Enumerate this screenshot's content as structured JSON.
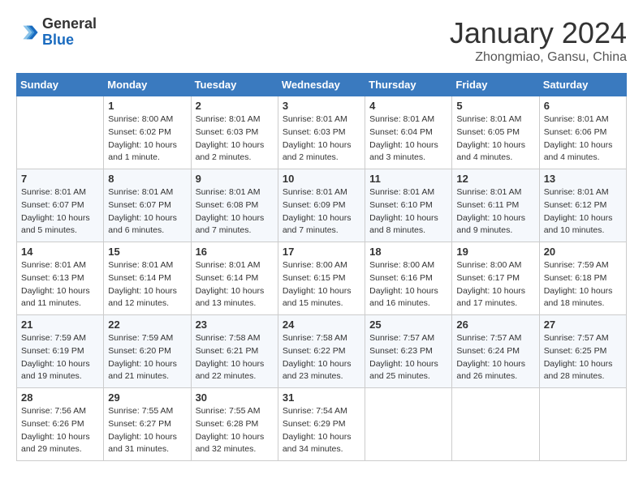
{
  "header": {
    "logo_line1": "General",
    "logo_line2": "Blue",
    "month_title": "January 2024",
    "location": "Zhongmiao, Gansu, China"
  },
  "columns": [
    "Sunday",
    "Monday",
    "Tuesday",
    "Wednesday",
    "Thursday",
    "Friday",
    "Saturday"
  ],
  "weeks": [
    [
      {
        "day": "",
        "info": ""
      },
      {
        "day": "1",
        "info": "Sunrise: 8:00 AM\nSunset: 6:02 PM\nDaylight: 10 hours\nand 1 minute."
      },
      {
        "day": "2",
        "info": "Sunrise: 8:01 AM\nSunset: 6:03 PM\nDaylight: 10 hours\nand 2 minutes."
      },
      {
        "day": "3",
        "info": "Sunrise: 8:01 AM\nSunset: 6:03 PM\nDaylight: 10 hours\nand 2 minutes."
      },
      {
        "day": "4",
        "info": "Sunrise: 8:01 AM\nSunset: 6:04 PM\nDaylight: 10 hours\nand 3 minutes."
      },
      {
        "day": "5",
        "info": "Sunrise: 8:01 AM\nSunset: 6:05 PM\nDaylight: 10 hours\nand 4 minutes."
      },
      {
        "day": "6",
        "info": "Sunrise: 8:01 AM\nSunset: 6:06 PM\nDaylight: 10 hours\nand 4 minutes."
      }
    ],
    [
      {
        "day": "7",
        "info": "Sunrise: 8:01 AM\nSunset: 6:07 PM\nDaylight: 10 hours\nand 5 minutes."
      },
      {
        "day": "8",
        "info": "Sunrise: 8:01 AM\nSunset: 6:07 PM\nDaylight: 10 hours\nand 6 minutes."
      },
      {
        "day": "9",
        "info": "Sunrise: 8:01 AM\nSunset: 6:08 PM\nDaylight: 10 hours\nand 7 minutes."
      },
      {
        "day": "10",
        "info": "Sunrise: 8:01 AM\nSunset: 6:09 PM\nDaylight: 10 hours\nand 7 minutes."
      },
      {
        "day": "11",
        "info": "Sunrise: 8:01 AM\nSunset: 6:10 PM\nDaylight: 10 hours\nand 8 minutes."
      },
      {
        "day": "12",
        "info": "Sunrise: 8:01 AM\nSunset: 6:11 PM\nDaylight: 10 hours\nand 9 minutes."
      },
      {
        "day": "13",
        "info": "Sunrise: 8:01 AM\nSunset: 6:12 PM\nDaylight: 10 hours\nand 10 minutes."
      }
    ],
    [
      {
        "day": "14",
        "info": "Sunrise: 8:01 AM\nSunset: 6:13 PM\nDaylight: 10 hours\nand 11 minutes."
      },
      {
        "day": "15",
        "info": "Sunrise: 8:01 AM\nSunset: 6:14 PM\nDaylight: 10 hours\nand 12 minutes."
      },
      {
        "day": "16",
        "info": "Sunrise: 8:01 AM\nSunset: 6:14 PM\nDaylight: 10 hours\nand 13 minutes."
      },
      {
        "day": "17",
        "info": "Sunrise: 8:00 AM\nSunset: 6:15 PM\nDaylight: 10 hours\nand 15 minutes."
      },
      {
        "day": "18",
        "info": "Sunrise: 8:00 AM\nSunset: 6:16 PM\nDaylight: 10 hours\nand 16 minutes."
      },
      {
        "day": "19",
        "info": "Sunrise: 8:00 AM\nSunset: 6:17 PM\nDaylight: 10 hours\nand 17 minutes."
      },
      {
        "day": "20",
        "info": "Sunrise: 7:59 AM\nSunset: 6:18 PM\nDaylight: 10 hours\nand 18 minutes."
      }
    ],
    [
      {
        "day": "21",
        "info": "Sunrise: 7:59 AM\nSunset: 6:19 PM\nDaylight: 10 hours\nand 19 minutes."
      },
      {
        "day": "22",
        "info": "Sunrise: 7:59 AM\nSunset: 6:20 PM\nDaylight: 10 hours\nand 21 minutes."
      },
      {
        "day": "23",
        "info": "Sunrise: 7:58 AM\nSunset: 6:21 PM\nDaylight: 10 hours\nand 22 minutes."
      },
      {
        "day": "24",
        "info": "Sunrise: 7:58 AM\nSunset: 6:22 PM\nDaylight: 10 hours\nand 23 minutes."
      },
      {
        "day": "25",
        "info": "Sunrise: 7:57 AM\nSunset: 6:23 PM\nDaylight: 10 hours\nand 25 minutes."
      },
      {
        "day": "26",
        "info": "Sunrise: 7:57 AM\nSunset: 6:24 PM\nDaylight: 10 hours\nand 26 minutes."
      },
      {
        "day": "27",
        "info": "Sunrise: 7:57 AM\nSunset: 6:25 PM\nDaylight: 10 hours\nand 28 minutes."
      }
    ],
    [
      {
        "day": "28",
        "info": "Sunrise: 7:56 AM\nSunset: 6:26 PM\nDaylight: 10 hours\nand 29 minutes."
      },
      {
        "day": "29",
        "info": "Sunrise: 7:55 AM\nSunset: 6:27 PM\nDaylight: 10 hours\nand 31 minutes."
      },
      {
        "day": "30",
        "info": "Sunrise: 7:55 AM\nSunset: 6:28 PM\nDaylight: 10 hours\nand 32 minutes."
      },
      {
        "day": "31",
        "info": "Sunrise: 7:54 AM\nSunset: 6:29 PM\nDaylight: 10 hours\nand 34 minutes."
      },
      {
        "day": "",
        "info": ""
      },
      {
        "day": "",
        "info": ""
      },
      {
        "day": "",
        "info": ""
      }
    ]
  ]
}
